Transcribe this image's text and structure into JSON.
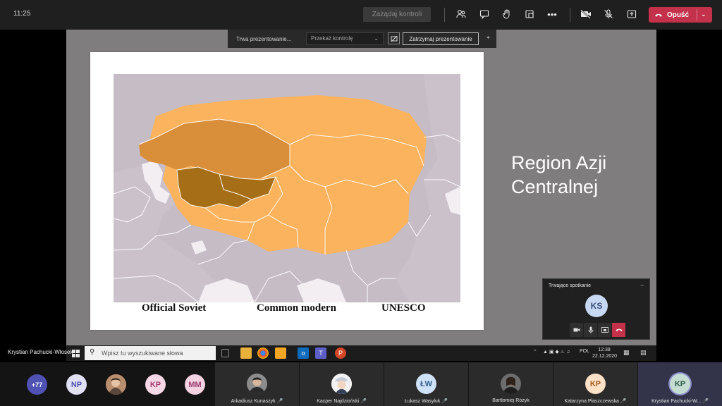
{
  "topbar": {
    "time": "11:25",
    "take_control": "Zażądaj kontroli",
    "leave_label": "Opuść",
    "icons": [
      "participants-icon",
      "chat-icon",
      "raise-hand-icon",
      "breakout-icon",
      "more-icon",
      "camera-off-icon",
      "mic-off-icon",
      "share-icon"
    ]
  },
  "presenting_bar": {
    "status": "Trwa prezentowanie...",
    "give_control": "Przekaż kontrolę",
    "stop": "Zatrzymaj prezentowanie"
  },
  "slide": {
    "title": "Region Azji Centralnej",
    "caption": [
      "Official Soviet",
      "Common modern",
      "UNESCO"
    ],
    "colors": {
      "sea": "#c6bcc6",
      "land": "#f2eef2",
      "region_light": "#fcb35d",
      "region_mid": "#d98e3a",
      "region_dark": "#a66f17"
    }
  },
  "mini_window": {
    "header": "Trwające spotkanie",
    "avatar": "KS",
    "icons": [
      "camera-icon",
      "mic-icon",
      "share-icon",
      "hangup-icon"
    ]
  },
  "presenter": "Krystian Pachucki-Włosek",
  "taskbar": {
    "search_placeholder": "Wpisz tu wyszukiwane słowa",
    "lang": "POL",
    "time": "12:38",
    "date": "22.12.2020"
  },
  "participants": {
    "overflow": "+77",
    "avatars": [
      "NP",
      "KP",
      "MM"
    ],
    "tiles": [
      {
        "name": "Arkadiusz Kunaszyk",
        "initials": ""
      },
      {
        "name": "Kacper Najdzioński",
        "initials": ""
      },
      {
        "name": "Łukasz Wasyluk",
        "initials": "ŁW"
      },
      {
        "name": "Bartłomiej Różyk",
        "initials": ""
      },
      {
        "name": "Katarzyna Płaszczewska",
        "initials": "KP"
      },
      {
        "name": "Krystian Pachucki-W...",
        "initials": "KP"
      }
    ]
  }
}
